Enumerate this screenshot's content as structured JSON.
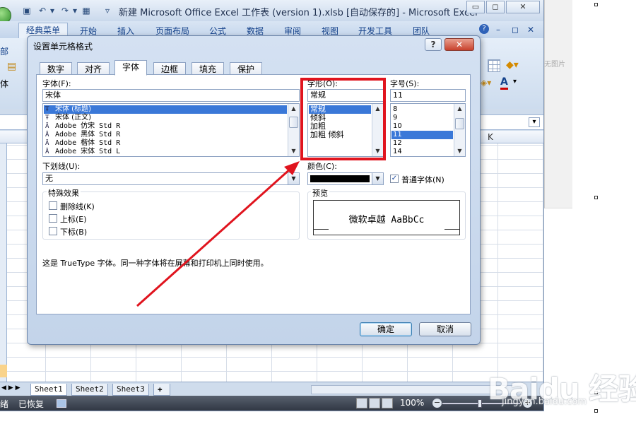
{
  "window": {
    "title": "新建 Microsoft Office Excel 工作表 (version 1).xlsb [自动保存的] - Microsoft Excel",
    "minimize": "▭",
    "restore": "◻",
    "close": "✕"
  },
  "menu": {
    "items": [
      "经典菜单",
      "开始",
      "插入",
      "页面布局",
      "公式",
      "数据",
      "审阅",
      "视图",
      "开发工具",
      "团队"
    ]
  },
  "ribbon": {
    "left_label_1": "部",
    "left_label_2": "体"
  },
  "sheet": {
    "column_k": "K",
    "tabs": [
      "Sheet1",
      "Sheet2",
      "Sheet3"
    ]
  },
  "status": {
    "ready": "绪",
    "recovered": "已恢复",
    "zoom": "100%"
  },
  "background": {
    "no_picture": "无图片"
  },
  "watermark": {
    "text": "Baidu 经验",
    "url": "jingyan.baidu.com"
  },
  "dialog": {
    "title": "设置单元格格式",
    "help": "?",
    "close": "✕",
    "tabs": [
      "数字",
      "对齐",
      "字体",
      "边框",
      "填充",
      "保护"
    ],
    "active_tab": "字体",
    "font": {
      "label": "字体(F):",
      "value": "宋体",
      "items": [
        {
          "glyph": "Ŧ",
          "name": "宋体 (标题)",
          "selected": true
        },
        {
          "glyph": "Ŧ",
          "name": "宋体 (正文)",
          "selected": false
        },
        {
          "glyph": "Ā",
          "name": "Adobe 仿宋 Std R",
          "selected": false
        },
        {
          "glyph": "Ā",
          "name": "Adobe 黑体 Std R",
          "selected": false
        },
        {
          "glyph": "Ā",
          "name": "Adobe 楷体 Std R",
          "selected": false
        },
        {
          "glyph": "Ā",
          "name": "Adobe 宋体 Std L",
          "selected": false
        }
      ]
    },
    "style": {
      "label": "字形(O):",
      "value": "常规",
      "items": [
        {
          "name": "常规",
          "selected": true
        },
        {
          "name": "倾斜",
          "selected": false
        },
        {
          "name": "加粗",
          "selected": false
        },
        {
          "name": "加粗 倾斜",
          "selected": false
        }
      ]
    },
    "size": {
      "label": "字号(S):",
      "value": "11",
      "items": [
        {
          "name": "8",
          "selected": false
        },
        {
          "name": "9",
          "selected": false
        },
        {
          "name": "10",
          "selected": false
        },
        {
          "name": "11",
          "selected": true
        },
        {
          "name": "12",
          "selected": false
        },
        {
          "name": "14",
          "selected": false
        }
      ]
    },
    "underline": {
      "label": "下划线(U):",
      "value": "无"
    },
    "color": {
      "label": "颜色(C):",
      "swatch": "#000000"
    },
    "normal_font": {
      "label": "普通字体(N)",
      "checked": true
    },
    "effects": {
      "label": "特殊效果",
      "strikethrough": "删除线(K)",
      "superscript": "上标(E)",
      "subscript": "下标(B)"
    },
    "preview": {
      "label": "预览",
      "sample": "微软卓越  AaBbCc"
    },
    "description": "这是 TrueType 字体。同一种字体将在屏幕和打印机上同时使用。",
    "ok": "确定",
    "cancel": "取消"
  },
  "annotation": {
    "highlight_color": "#e0141e"
  }
}
